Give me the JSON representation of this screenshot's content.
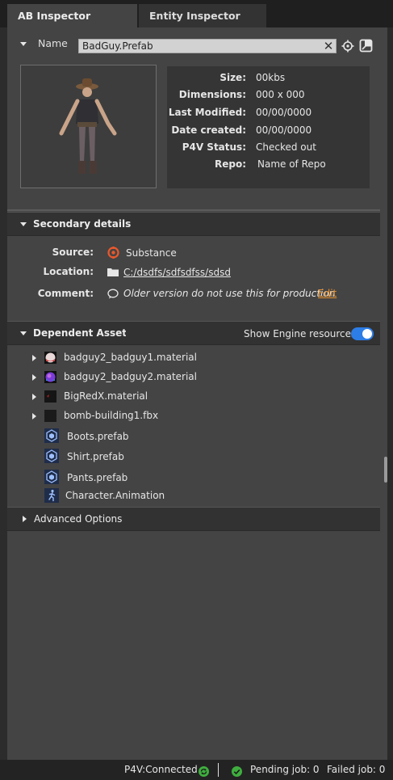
{
  "tabs": [
    {
      "label": "AB Inspector"
    },
    {
      "label": "Entity Inspector"
    }
  ],
  "header": {
    "name_label": "Name",
    "name_value": "BadGuy.Prefab"
  },
  "info": [
    {
      "key": "Size:",
      "value": "00kbs"
    },
    {
      "key": "Dimensions:",
      "value": "000 x 000"
    },
    {
      "key": "Last Modified:",
      "value": "00/00/0000"
    },
    {
      "key": "Date created:",
      "value": "00/00/0000"
    },
    {
      "key": "P4V Status:",
      "value": "Checked out"
    },
    {
      "key": "Repo:",
      "value": "Name of Repo"
    }
  ],
  "secondary": {
    "title": "Secondary details",
    "source_label": "Source:",
    "source_value": "Substance",
    "location_label": "Location:",
    "location_value": "C:/dsdfs/sdfsdfss/sdsd",
    "comment_label": "Comment:",
    "comment_value": "Older version do not use this for production",
    "edit_label": "Edit"
  },
  "dependent": {
    "title": "Dependent Asset:",
    "show_engine_label": "Show Engine resources",
    "show_engine_on": true,
    "items": [
      {
        "label": "badguy2_badguy1.material",
        "icon": "material-sphere-icon",
        "expandable": true
      },
      {
        "label": "badguy2_badguy2.material",
        "icon": "material-sphere-icon",
        "expandable": true
      },
      {
        "label": "BigRedX.material",
        "icon": "material-swatch-icon",
        "expandable": true
      },
      {
        "label": "bomb-building1.fbx",
        "icon": "fbx-model-icon",
        "expandable": true
      },
      {
        "label": "Boots.prefab",
        "icon": "prefab-icon",
        "expandable": false
      },
      {
        "label": "Shirt.prefab",
        "icon": "prefab-icon",
        "expandable": false
      },
      {
        "label": "Pants.prefab",
        "icon": "prefab-icon",
        "expandable": false
      },
      {
        "label": "Character.Animation",
        "icon": "animation-icon",
        "expandable": false
      }
    ]
  },
  "advanced": {
    "title": "Advanced Options"
  },
  "status": {
    "p4v": "P4V:Connected",
    "pending": "Pending job: 0",
    "failed": "Failed job: 0"
  },
  "colors": {
    "accent": "#2d7de6",
    "link": "#e8902c",
    "ok": "#3fae3f"
  }
}
